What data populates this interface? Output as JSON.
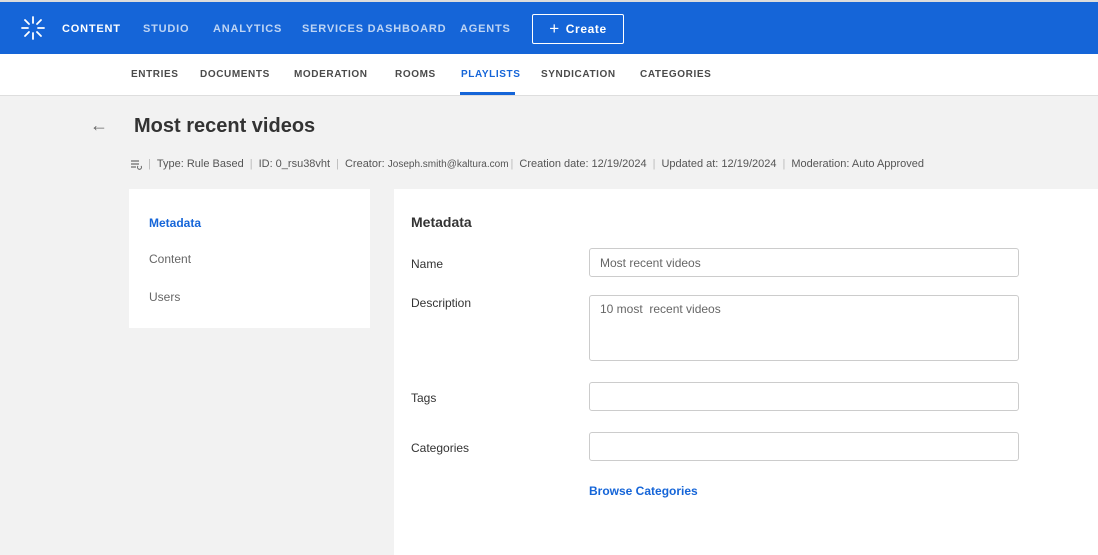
{
  "colors": {
    "brand": "#1565d8",
    "text": "#333333",
    "muted": "#666666",
    "background": "#f2f2f2"
  },
  "topnav": {
    "logo_icon": "kaltura-burst-icon",
    "items": [
      {
        "label": "CONTENT",
        "active": true
      },
      {
        "label": "STUDIO"
      },
      {
        "label": "ANALYTICS"
      },
      {
        "label": "SERVICES DASHBOARD"
      },
      {
        "label": "AGENTS"
      }
    ],
    "create_label": "Create"
  },
  "subnav": {
    "items": [
      {
        "label": "ENTRIES"
      },
      {
        "label": "DOCUMENTS"
      },
      {
        "label": "MODERATION"
      },
      {
        "label": "ROOMS"
      },
      {
        "label": "PLAYLISTS",
        "active": true
      },
      {
        "label": "SYNDICATION"
      },
      {
        "label": "CATEGORIES"
      }
    ]
  },
  "header": {
    "back_icon": "arrow-left-icon",
    "title": "Most recent videos",
    "type": "Type: Rule Based",
    "id": "ID: 0_rsu38vht",
    "creator_label": "Creator:",
    "creator_value": "Joseph.smith@kaltura.com",
    "creation_date": "Creation date: 12/19/2024",
    "updated_at": "Updated at: 12/19/2024",
    "moderation": "Moderation: Auto Approved"
  },
  "sidebar": {
    "items": [
      {
        "label": "Metadata",
        "active": true
      },
      {
        "label": "Content"
      },
      {
        "label": "Users"
      }
    ]
  },
  "form": {
    "section_title": "Metadata",
    "name_label": "Name",
    "name_value": "Most recent videos",
    "description_label": "Description",
    "description_value": "10 most  recent videos",
    "tags_label": "Tags",
    "tags_value": "",
    "categories_label": "Categories",
    "categories_value": "",
    "browse_label": "Browse Categories"
  }
}
